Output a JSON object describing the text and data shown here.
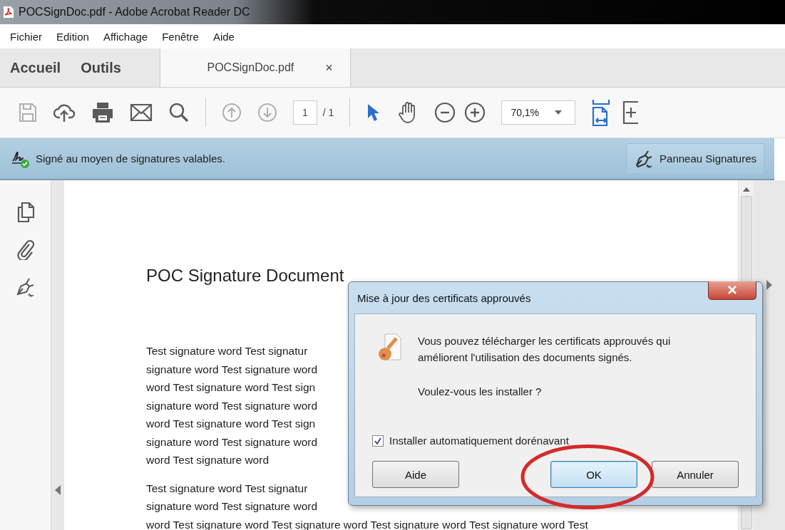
{
  "window": {
    "title": "POCSignDoc.pdf - Adobe Acrobat Reader DC"
  },
  "menu": [
    "Fichier",
    "Edition",
    "Affichage",
    "Fenêtre",
    "Aide"
  ],
  "tabs": [
    {
      "label": "Accueil",
      "kind": "home",
      "selected": false
    },
    {
      "label": "Outils",
      "kind": "home",
      "selected": false
    },
    {
      "label": "POCSignDoc.pdf",
      "kind": "document",
      "selected": true,
      "close": "×"
    }
  ],
  "toolbar": {
    "tools": [
      {
        "kind": "save",
        "disabled": true
      },
      {
        "kind": "upload",
        "disabled": false
      },
      {
        "kind": "print",
        "disabled": false
      },
      {
        "kind": "mail",
        "disabled": false
      },
      {
        "kind": "search",
        "disabled": false
      },
      {
        "kind": "separator"
      },
      {
        "kind": "prev",
        "disabled": true
      },
      {
        "kind": "next",
        "disabled": true
      }
    ],
    "page": "1",
    "page_total": "/ 1",
    "modes": [
      {
        "kind": "select",
        "selected": true
      },
      {
        "kind": "hand",
        "selected": false
      }
    ],
    "zoom": "70,1%"
  },
  "signature_bar": {
    "message": "Signé au moyen de signatures valables.",
    "button": "Panneau Signatures"
  },
  "document": {
    "title": "POC Signature Document",
    "paragraphs": [
      [
        "Test signature word Test signatur",
        "signature word Test signature word",
        "word Test signature word Test sign",
        "signature word Test signature word",
        "word Test signature word Test sign",
        "signature word Test signature word",
        "word Test signature word"
      ],
      [
        "Test signature word Test signatur",
        "signature word Test signature word",
        "word Test signature word Test signature word Test signature word Test signature word Test"
      ]
    ]
  },
  "dialog": {
    "title": "Mise à jour des certificats approuvés",
    "message": "Vous pouvez télécharger les certificats approuvés qui améliorent l'utilisation des documents signés.",
    "question": "Voulez-vous les installer ?",
    "checkbox": {
      "label": "Installer automatiquement dorénavant",
      "checked": true
    },
    "buttons": [
      {
        "label": "Aide",
        "default": false
      },
      {
        "label": "OK",
        "default": true
      },
      {
        "label": "Annuler",
        "default": false
      }
    ]
  }
}
